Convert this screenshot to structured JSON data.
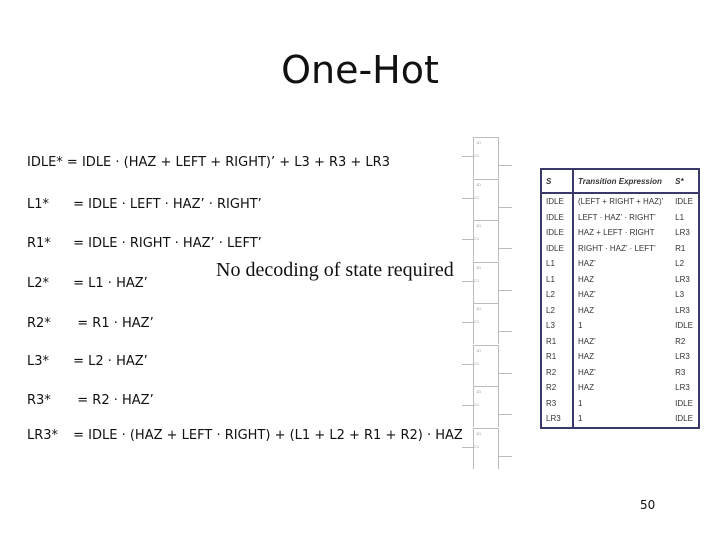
{
  "title": "One-Hot",
  "equations": [
    {
      "lhs": "IDLE* =",
      "rhs": "IDLE · (HAZ + LEFT + RIGHT)’ + L3 + R3 + LR3"
    },
    {
      "lhs": "L1*",
      "rhs": "= IDLE · LEFT · HAZ’ · RIGHT’"
    },
    {
      "lhs": "R1*",
      "rhs": "= IDLE · RIGHT · HAZ’ · LEFT’"
    },
    {
      "lhs": "L2*",
      "rhs": "= L1 · HAZ’"
    },
    {
      "lhs": "R2*",
      "rhs": " = R1 · HAZ’"
    },
    {
      "lhs": "L3*",
      "rhs": "= L2 · HAZ’"
    },
    {
      "lhs": "R3*",
      "rhs": " = R2 · HAZ’"
    },
    {
      "lhs": "LR3*",
      "rhs": "= IDLE · (HAZ + LEFT · RIGHT) + (L1 + L2 + R1 + R2) · HAZ"
    }
  ],
  "note": "No decoding of state required",
  "flipflop": {
    "d": "1D",
    "c": "C1"
  },
  "table": {
    "headers": [
      "S",
      "Transition Expression",
      "S*"
    ],
    "rows": [
      [
        "IDLE",
        "(LEFT + RIGHT + HAZ)’",
        "IDLE"
      ],
      [
        "IDLE",
        "LEFT · HAZ’ · RIGHT’",
        "L1"
      ],
      [
        "IDLE",
        "HAZ + LEFT · RIGHT",
        "LR3"
      ],
      [
        "IDLE",
        "RIGHT · HAZ’ · LEFT’",
        "R1"
      ],
      [
        "L1",
        "HAZ’",
        "L2"
      ],
      [
        "L1",
        "HAZ",
        "LR3"
      ],
      [
        "L2",
        "HAZ’",
        "L3"
      ],
      [
        "L2",
        "HAZ",
        "LR3"
      ],
      [
        "L3",
        "1",
        "IDLE"
      ],
      [
        "R1",
        "HAZ’",
        "R2"
      ],
      [
        "R1",
        "HAZ",
        "LR3"
      ],
      [
        "R2",
        "HAZ’",
        "R3"
      ],
      [
        "R2",
        "HAZ",
        "LR3"
      ],
      [
        "R3",
        "1",
        "IDLE"
      ],
      [
        "LR3",
        "1",
        "IDLE"
      ]
    ]
  },
  "page_number": "50"
}
